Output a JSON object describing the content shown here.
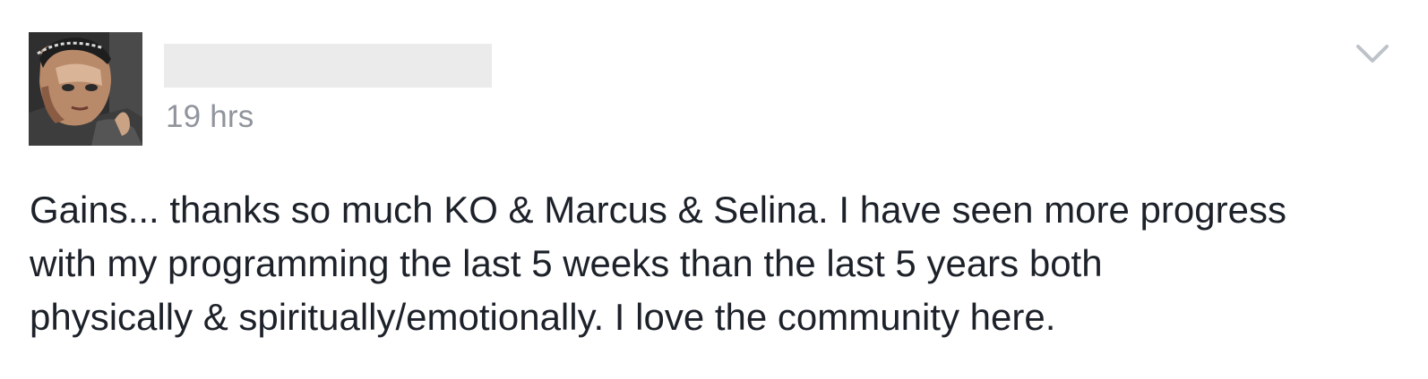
{
  "post": {
    "author_name": "",
    "timestamp": "19 hrs",
    "text": "Gains... thanks so much KO & Marcus & Selina. I have seen more progress\nwith my programming the last 5 weeks than the last 5 years both\nphysically & spiritually/emotionally. I love the community here.",
    "options_icon": "chevron-down-icon",
    "avatar": "profile-photo"
  },
  "colors": {
    "text": "#1d2129",
    "timestamp": "#90949c",
    "name_redaction": "#ebebeb",
    "chevron": "#bec2c9"
  }
}
